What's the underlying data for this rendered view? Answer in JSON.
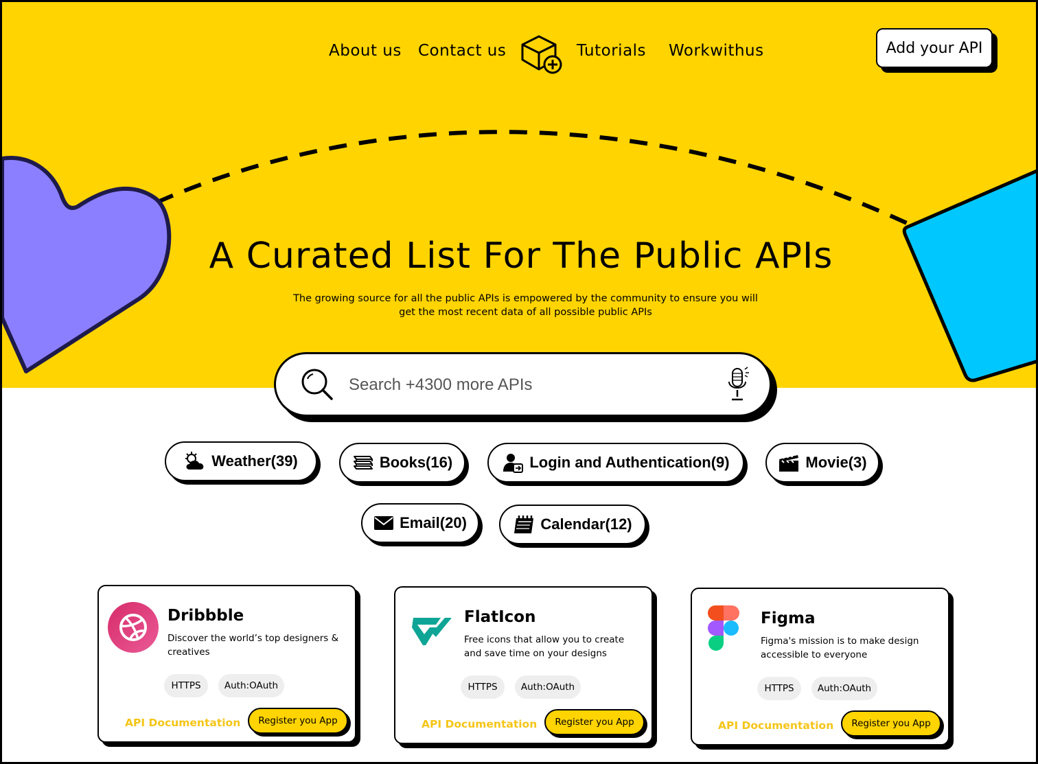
{
  "colors": {
    "hero_bg": "#FFD400",
    "heart": "#8B7FFF",
    "box": "#00C8FF",
    "doc_link": "#F5C518",
    "register_bg": "#FFD400"
  },
  "nav": {
    "about": "About us",
    "contact": "Contact us",
    "tutorials": "Tutorials",
    "work": "Workwithus",
    "logo_icon": "box-plus-icon",
    "add_api": "Add your API"
  },
  "hero": {
    "title": "A Curated List For The Public APIs",
    "subtitle_line1": "The growing source for all the public APIs is empowered by the community to ensure you will",
    "subtitle_line2": "get the most recent data of all possible public APIs"
  },
  "search": {
    "placeholder": "Search +4300 more APIs",
    "value": ""
  },
  "categories": [
    {
      "label": "Weather(39)",
      "icon": "weather-icon"
    },
    {
      "label": "Books(16)",
      "icon": "books-icon"
    },
    {
      "label": "Login and Authentication(9)",
      "icon": "user-login-icon"
    },
    {
      "label": "Movie(3)",
      "icon": "clapperboard-icon"
    },
    {
      "label": "Email(20)",
      "icon": "envelope-icon"
    },
    {
      "label": "Calendar(12)",
      "icon": "calendar-icon"
    }
  ],
  "cards": [
    {
      "name": "Dribbble",
      "desc": "Discover the world’s top designers & creatives",
      "tags": [
        "HTTPS",
        "Auth:OAuth"
      ],
      "doc": "API Documentation",
      "register": "Register you App"
    },
    {
      "name": "FlatIcon",
      "desc": "Free icons that allow you to  create and save time on your designs",
      "tags": [
        "HTTPS",
        "Auth:OAuth"
      ],
      "doc": "API Documentation",
      "register": "Register you App"
    },
    {
      "name": "Figma",
      "desc": "Figma's mission is to make design accessible to everyone",
      "tags": [
        "HTTPS",
        "Auth:OAuth"
      ],
      "doc": "API Documentation",
      "register": "Register you App"
    }
  ]
}
